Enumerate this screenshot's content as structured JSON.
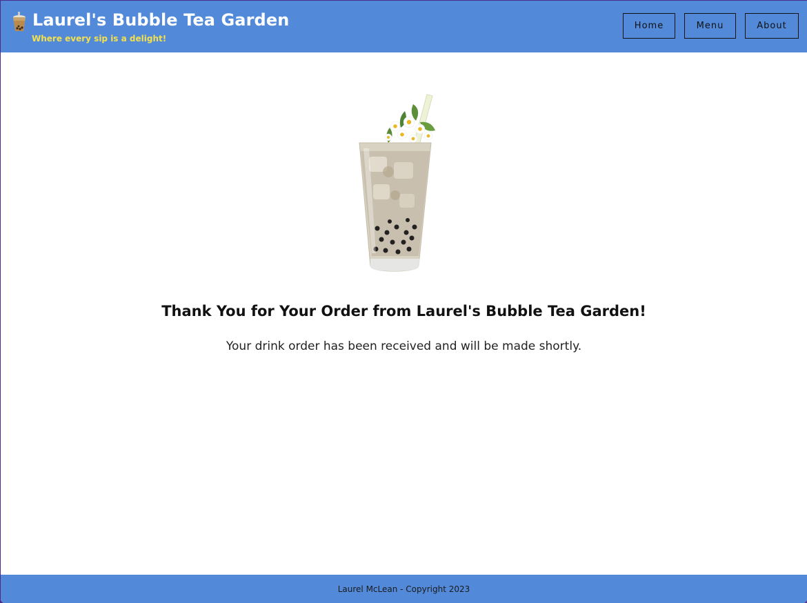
{
  "header": {
    "logo_icon": "bubble-tea-cup-icon",
    "title": "Laurel's Bubble Tea Garden",
    "tagline": "Where every sip is a delight!"
  },
  "nav": {
    "home": "Home",
    "menu": "Menu",
    "about": "About"
  },
  "main": {
    "image": "bubble-tea-drink-image",
    "heading": "Thank You for Your Order from Laurel's Bubble Tea Garden!",
    "message": "Your drink order has been received and will be made shortly."
  },
  "footer": {
    "copyright": "Laurel McLean - Copyright 2023"
  },
  "colors": {
    "header_bg": "#528ad9",
    "tagline": "#f4e04d",
    "footer_bg": "#528ad9"
  }
}
